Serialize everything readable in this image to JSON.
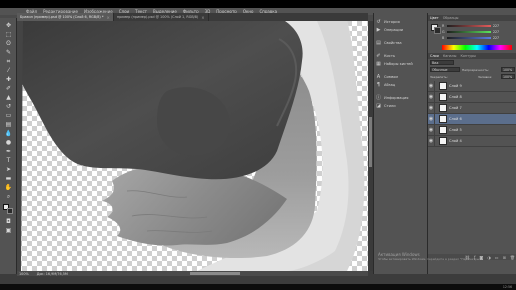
{
  "app": {
    "name": "Adobe Photoshop",
    "menu": [
      "Файл",
      "Редактирование",
      "Изображение",
      "Слои",
      "Текст",
      "Выделение",
      "Фильтр",
      "3D",
      "Просмотр",
      "Окно",
      "Справка"
    ]
  },
  "document_tabs": [
    {
      "label": "Бразил (пример).psd @ 100% (Слой 6, RGB/8) *",
      "active": true
    },
    {
      "label": "пример (пример).psd @ 100% (Слой 1, RGB/8)",
      "active": false
    }
  ],
  "status": {
    "zoom": "100%",
    "doc_info": "Док: 16,9M/76,5M"
  },
  "mini_dock": {
    "items": [
      {
        "label": "История",
        "icon": "history-icon"
      },
      {
        "label": "Операции",
        "icon": "actions-icon"
      },
      {
        "label": "Свойства",
        "icon": "properties-icon"
      },
      {
        "label": "Кисть",
        "icon": "brush-icon"
      },
      {
        "label": "Наборы кистей",
        "icon": "brush-presets-icon"
      },
      {
        "label": "Символ",
        "icon": "character-icon"
      },
      {
        "label": "Абзац",
        "icon": "paragraph-icon"
      },
      {
        "label": "Информация",
        "icon": "info-icon"
      },
      {
        "label": "Стили",
        "icon": "styles-icon"
      }
    ]
  },
  "color_panel": {
    "tabs": [
      "Цвет",
      "Образцы"
    ],
    "sliders": [
      {
        "label": "R",
        "value": "227",
        "color": "#e35b5b"
      },
      {
        "label": "G",
        "value": "227",
        "color": "#5be35b"
      },
      {
        "label": "B",
        "value": "227",
        "color": "#5b7be3"
      }
    ],
    "foreground": "#e8e8e8",
    "background": "#2b2b2b"
  },
  "layers_panel": {
    "tabs": [
      "Слои",
      "Каналы",
      "Контуры"
    ],
    "kind_filter": "Вид",
    "blend_mode": "Обычные",
    "opacity_label": "Непрозрачность:",
    "opacity_value": "100%",
    "lock_label": "Закрепить:",
    "fill_label": "Заливка:",
    "fill_value": "100%",
    "layers": [
      {
        "name": "Слой 9",
        "selected": false
      },
      {
        "name": "Слой 8",
        "selected": false
      },
      {
        "name": "Слой 7",
        "selected": false
      },
      {
        "name": "Слой 6",
        "selected": true
      },
      {
        "name": "Слой 5",
        "selected": false
      },
      {
        "name": "Слой 4",
        "selected": false
      }
    ],
    "footer_icons": [
      "link-icon",
      "fx-icon",
      "mask-icon",
      "adjustment-icon",
      "folder-icon",
      "new-layer-icon",
      "trash-icon"
    ]
  },
  "watermark": {
    "title": "Активация Windows",
    "subtitle": "Чтобы активировать Windows, перейдите в раздел \"Параметры\"."
  },
  "taskbar": {
    "time": "12:56"
  }
}
